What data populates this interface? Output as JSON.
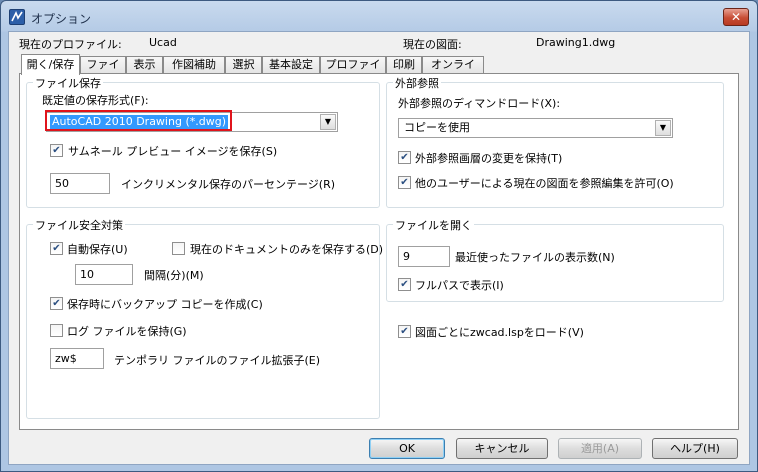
{
  "window": {
    "title": "オプション",
    "close_label": "✕"
  },
  "profile": {
    "current_profile_label": "現在のプロファイル:",
    "current_profile_value": "Ucad",
    "current_drawing_label": "現在の図面:",
    "current_drawing_value": "Drawing1.dwg"
  },
  "tabs": [
    {
      "label": "開く/保存",
      "active": true
    },
    {
      "label": "ファイル"
    },
    {
      "label": "表示"
    },
    {
      "label": "作図補助"
    },
    {
      "label": "選択"
    },
    {
      "label": "基本設定"
    },
    {
      "label": "プロファイル"
    },
    {
      "label": "印刷"
    },
    {
      "label": "オンライン"
    }
  ],
  "file_save": {
    "group_title": "ファイル保存",
    "format_label": "既定値の保存形式(F):",
    "format_value": "AutoCAD 2010 Drawing (*.dwg)",
    "thumbnail_label": "サムネール プレビュー イメージを保存(S)",
    "thumbnail_checked": true,
    "incremental_value": "50",
    "incremental_label": "インクリメンタル保存のパーセンテージ(R)"
  },
  "file_safety": {
    "group_title": "ファイル安全対策",
    "autosave_label": "自動保存(U)",
    "autosave_checked": true,
    "current_doc_only_label": "現在のドキュメントのみを保存する(D)",
    "current_doc_only_checked": false,
    "interval_value": "10",
    "interval_label": "間隔(分)(M)",
    "backup_label": "保存時にバックアップ コピーを作成(C)",
    "backup_checked": true,
    "log_label": "ログ ファイルを保持(G)",
    "log_checked": false,
    "temp_ext_value": "zw$",
    "temp_ext_label": "テンポラリ ファイルのファイル拡張子(E)"
  },
  "xref": {
    "group_title": "外部参照",
    "demand_load_label": "外部参照のディマンドロード(X):",
    "demand_load_value": "コピーを使用",
    "keep_layer_changes_label": "外部参照画層の変更を保持(T)",
    "keep_layer_changes_checked": true,
    "allow_edit_label": "他のユーザーによる現在の図面を参照編集を許可(O)",
    "allow_edit_checked": true
  },
  "file_open": {
    "group_title": "ファイルを開く",
    "recent_count_value": "9",
    "recent_count_label": "最近使ったファイルの表示数(N)",
    "full_path_label": "フルパスで表示(I)",
    "full_path_checked": true
  },
  "lsp": {
    "load_label": "図面ごとにzwcad.lspをロード(V)",
    "load_checked": true
  },
  "buttons": {
    "ok": "OK",
    "cancel": "キャンセル",
    "apply": "適用(A)",
    "help": "ヘルプ(H)"
  },
  "colors": {
    "highlight": "#3399ff",
    "annotation_box": "#e0141c",
    "title_bar": "#b5cbe6"
  }
}
